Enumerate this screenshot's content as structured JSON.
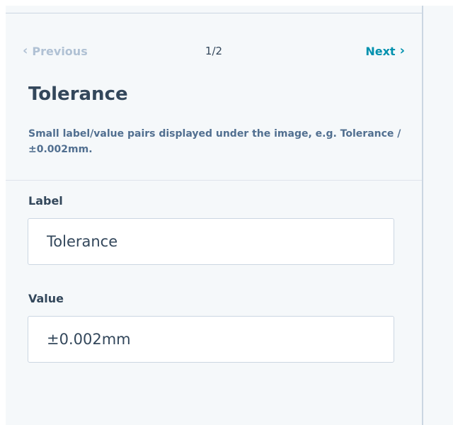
{
  "pager": {
    "previous_label": "Previous",
    "previous_icon": "chevron-left-icon",
    "count": "1/2",
    "next_label": "Next",
    "next_icon": "chevron-right-icon"
  },
  "header": {
    "title": "Tolerance",
    "description": "Small label/value pairs displayed under the image, e.g. Tolerance / ±0.002mm."
  },
  "fields": {
    "label": {
      "label": "Label",
      "value": "Tolerance"
    },
    "value": {
      "label": "Value",
      "value": "±0.002mm"
    }
  },
  "colors": {
    "link": "#0091ae",
    "text": "#33475b",
    "muted": "#b0c1d4",
    "panel_bg": "#f5f8fa",
    "border": "#cbd6e2"
  }
}
